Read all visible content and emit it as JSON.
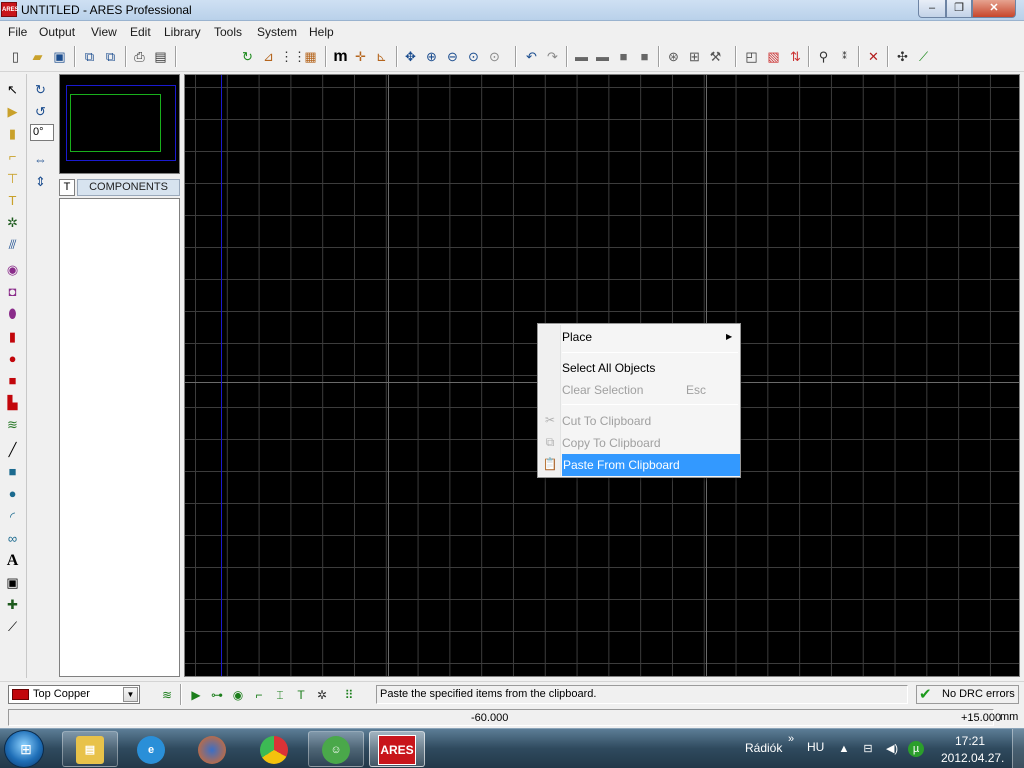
{
  "window": {
    "app_icon_text": "ARES",
    "title": "UNTITLED - ARES Professional",
    "minimize_glyph": "–",
    "maximize_glyph": "❐",
    "close_glyph": "✕"
  },
  "menu": {
    "items": [
      {
        "label": "File"
      },
      {
        "label": "Output"
      },
      {
        "label": "View"
      },
      {
        "label": "Edit"
      },
      {
        "label": "Library"
      },
      {
        "label": "Tools"
      },
      {
        "label": "System"
      },
      {
        "label": "Help"
      }
    ]
  },
  "toolbar": {
    "icons": [
      "new-file-icon",
      "open-folder-icon",
      "save-icon",
      "import-icon",
      "export-icon",
      "print-icon",
      "print-setup-icon",
      "refresh-icon",
      "gerber-icon",
      "grid-icon",
      "drill-icon",
      "metric-icon",
      "origin-icon",
      "false-origin-icon",
      "pan-icon",
      "zoom-in-icon",
      "zoom-out-icon",
      "zoom-all-icon",
      "zoom-area-icon",
      "undo-icon",
      "redo-icon",
      "block-copy-icon",
      "block-move-icon",
      "block-rotate-icon",
      "block-delete-icon",
      "pick-parts-icon",
      "make-package-icon",
      "decompose-icon",
      "connectivity-icon",
      "design-rules-icon",
      "ratsnest-icon",
      "search-tag-icon",
      "property-assign-icon",
      "autoplacer-icon",
      "autorouter-icon",
      "power-plane-icon",
      "3d-view-icon"
    ],
    "metric_label": "m"
  },
  "left_tools": {
    "icons": [
      "select-icon",
      "component-icon",
      "package-icon",
      "track-icon",
      "via-icon",
      "zone-icon",
      "ratsnest-icon",
      "connectivity-icon",
      "round-pad-icon",
      "square-pad-icon",
      "dil-pad-icon",
      "edge-pad-icon",
      "circular-smt-icon",
      "rect-smt-icon",
      "polygonal-pad-icon",
      "padstack-icon",
      "line-icon",
      "box-icon",
      "circle-icon",
      "arc-icon",
      "path-icon",
      "text-icon",
      "symbol-icon",
      "marker-icon",
      "dimension-icon"
    ],
    "text_tool_label": "A"
  },
  "rotation": {
    "rotate_cw_icon": "rotate-clockwise-icon",
    "rotate_ccw_icon": "rotate-anticlockwise-icon",
    "angle_value": "0°",
    "flip_h_icon": "flip-horizontal-icon",
    "flip_v_icon": "flip-vertical-icon"
  },
  "components_panel": {
    "tab_label": "T",
    "title": "COMPONENTS"
  },
  "context_menu": {
    "items": [
      {
        "label": "Place",
        "enabled": true,
        "has_submenu": true,
        "submenu_glyph": "▶",
        "icon": ""
      },
      {
        "label": "Select All Objects",
        "enabled": true,
        "has_submenu": false,
        "icon": ""
      },
      {
        "label": "Clear Selection",
        "shortcut": "Esc",
        "enabled": false,
        "icon": ""
      },
      {
        "label": "Cut To Clipboard",
        "enabled": false,
        "icon": "scissors-icon"
      },
      {
        "label": "Copy To Clipboard",
        "enabled": false,
        "icon": "copy-icon"
      },
      {
        "label": "Paste From Clipboard",
        "enabled": true,
        "highlighted": true,
        "icon": "paste-icon"
      }
    ]
  },
  "status": {
    "layer": "Top Copper",
    "layer_color": "#c2060b",
    "dropdown_glyph": "▼",
    "message": "Paste the specified items from the clipboard.",
    "drc_text": "No DRC errors",
    "drc_glyph": "✔"
  },
  "coords": {
    "x": "-60.000",
    "y": "+15.000",
    "unit": "mm"
  },
  "taskbar": {
    "apps": [
      "explorer-icon",
      "internet-explorer-icon",
      "firefox-icon",
      "chrome-icon",
      "messenger-icon",
      "ares-icon"
    ],
    "ares_label": "ARES",
    "tray_label": "Rádiók",
    "tray_chevron": "»",
    "language": "HU",
    "time": "17:21",
    "date": "2012.04.27."
  },
  "colors": {
    "canvas_bg": "#000000",
    "grid": "#3c3c3c",
    "board_outline": "#19b01c",
    "origin_line": "#1a1ad0",
    "highlight": "#3399ff"
  }
}
